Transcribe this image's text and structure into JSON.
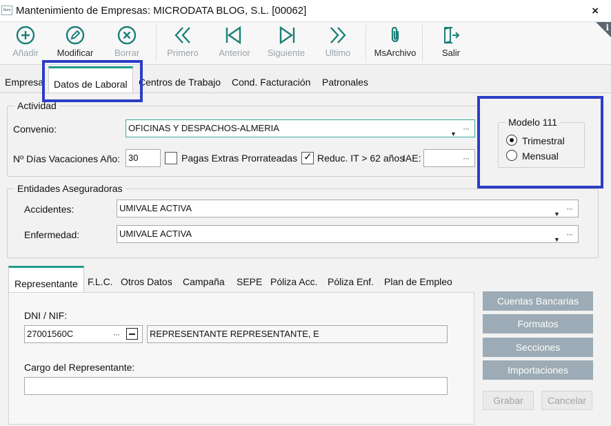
{
  "window": {
    "app_icon_text": "Nom",
    "title": "Mantenimiento de Empresas: MICRODATA BLOG, S.L. [00062]",
    "close_glyph": "×"
  },
  "toolbar": {
    "info_glyph": "i",
    "buttons": [
      {
        "label": "Añadir",
        "icon": "plus-circle-icon",
        "enabled": false
      },
      {
        "label": "Modificar",
        "icon": "pencil-circle-icon",
        "enabled": true
      },
      {
        "label": "Borrar",
        "icon": "x-circle-icon",
        "enabled": false
      },
      {
        "label": "Primero",
        "icon": "double-chevron-left-icon",
        "enabled": false
      },
      {
        "label": "Anterior",
        "icon": "triangle-left-icon",
        "enabled": false
      },
      {
        "label": "Siguiente",
        "icon": "triangle-right-icon",
        "enabled": false
      },
      {
        "label": "Ultimo",
        "icon": "double-chevron-right-icon",
        "enabled": false
      },
      {
        "label": "MsArchivo",
        "icon": "paperclip-icon",
        "enabled": true
      },
      {
        "label": "Salir",
        "icon": "exit-door-icon",
        "enabled": true
      }
    ]
  },
  "main_tabs": {
    "items": [
      "Empresa",
      "Datos de Laboral",
      "Centros de Trabajo",
      "Cond. Facturación",
      "Patronales"
    ],
    "active": "Datos de Laboral"
  },
  "actividad": {
    "title": "Actividad",
    "convenio_label": "Convenio:",
    "convenio_value": "OFICINAS Y DESPACHOS-ALMERIA",
    "vacaciones_label": "Nº Días Vacaciones Año:",
    "vacaciones_value": "30",
    "pagas_label": "Pagas Extras Prorrateadas",
    "pagas_checked": false,
    "reduc_label": "Reduc. IT > 62 años",
    "reduc_checked": true,
    "iae_label": "IAE:",
    "iae_value": ""
  },
  "modelo111": {
    "title": "Modelo 111",
    "options": [
      {
        "label": "Trimestral",
        "selected": true
      },
      {
        "label": "Mensual",
        "selected": false
      }
    ]
  },
  "entidades": {
    "title": "Entidades Aseguradoras",
    "accidentes_label": "Accidentes:",
    "accidentes_value": "UMIVALE ACTIVA",
    "enfermedad_label": "Enfermedad:",
    "enfermedad_value": "UMIVALE ACTIVA"
  },
  "sub_tabs": {
    "items": [
      "Representante",
      "F.L.C.",
      "Otros Datos",
      "Campaña",
      "SEPE",
      "Póliza Acc.",
      "Póliza Enf.",
      "Plan de Empleo"
    ],
    "active": "Representante"
  },
  "representante": {
    "dni_label": "DNI / NIF:",
    "dni_value": "27001560C",
    "dots": "···",
    "name_value": "REPRESENTANTE REPRESENTANTE, E",
    "cargo_label": "Cargo del Representante:",
    "cargo_value": ""
  },
  "side_buttons": [
    "Cuentas Bancarias",
    "Formatos",
    "Secciones",
    "Importaciones"
  ],
  "actions": {
    "grabar": "Grabar",
    "cancelar": "Cancelar"
  },
  "colors": {
    "accent": "#1e9b8a",
    "highlight": "#2c3ec4",
    "toolbar_icon": "#1a7f78",
    "side_button": "#9cabb5"
  }
}
